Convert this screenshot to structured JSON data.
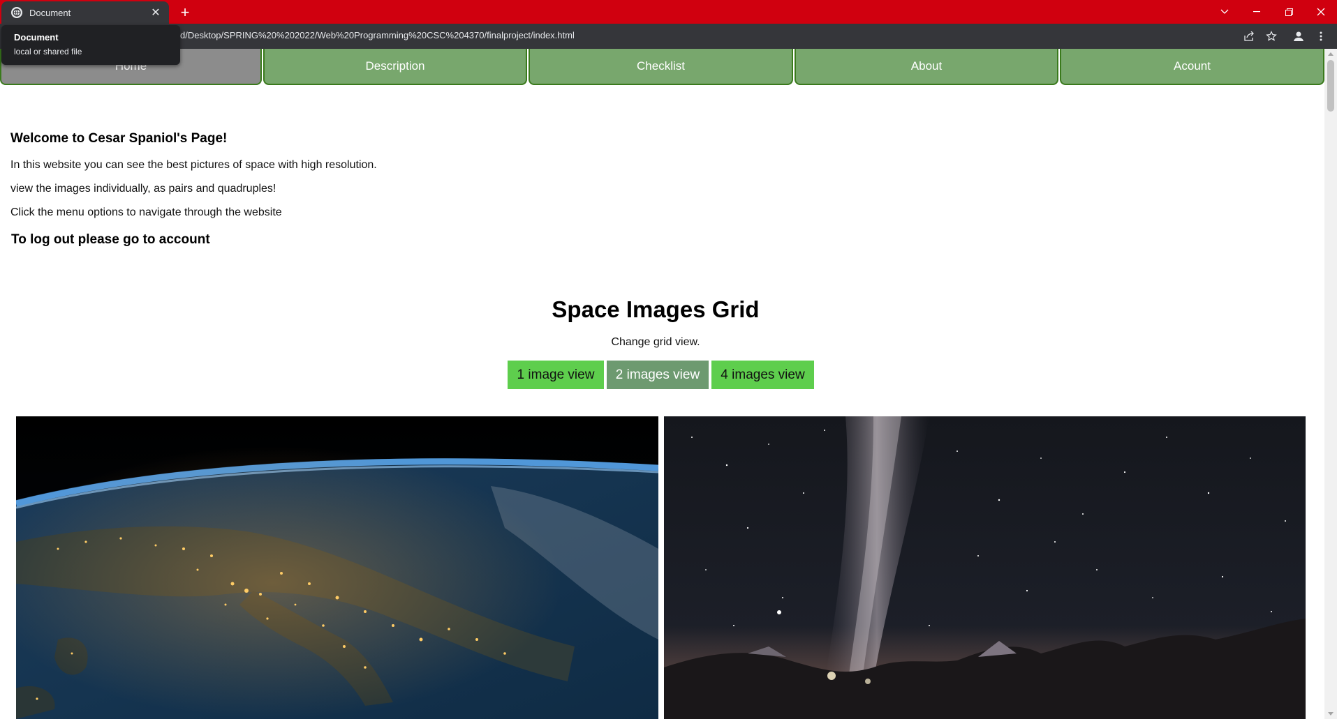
{
  "browser": {
    "tab_title": "Document",
    "new_tab_label": "+",
    "url": "d/Desktop/SPRING%20%202022/Web%20Programming%20CSC%204370/finalproject/index.html",
    "tooltip": {
      "title": "Document",
      "subtitle": "local or shared file"
    },
    "colors": {
      "frame": "#d0000f",
      "toolbar": "#35363a"
    },
    "icons": [
      "globe-icon",
      "close-icon",
      "chevron-down-icon",
      "minimize-icon",
      "restore-icon",
      "window-close-icon",
      "share-icon",
      "star-icon",
      "profile-icon",
      "menu-icon"
    ]
  },
  "nav": {
    "items": [
      {
        "label": "Home",
        "active": true
      },
      {
        "label": "Description",
        "active": false
      },
      {
        "label": "Checklist",
        "active": false
      },
      {
        "label": "About",
        "active": false
      },
      {
        "label": "Acount",
        "active": false
      }
    ],
    "colors": {
      "item": "#78a76d",
      "active": "#8c8c8c",
      "border": "#3a7a1c"
    }
  },
  "intro": {
    "heading": "Welcome to Cesar Spaniol's Page!",
    "lines": [
      "In this website you can see the best pictures of space with high resolution.",
      "view the images individually, as pairs and quadruples!",
      "Click the menu options to navigate through the website"
    ],
    "logout": "To log out please go to account"
  },
  "grid": {
    "title": "Space Images Grid",
    "subtitle": "Change grid view.",
    "buttons": [
      {
        "label": "1 image view",
        "active": false
      },
      {
        "label": "2 images view",
        "active": true
      },
      {
        "label": "4 images view",
        "active": false
      }
    ],
    "colors": {
      "button": "#5ece4d",
      "button_active": "#6d9a70"
    },
    "images": [
      {
        "name": "earth-at-night-image"
      },
      {
        "name": "milky-way-image"
      }
    ]
  }
}
